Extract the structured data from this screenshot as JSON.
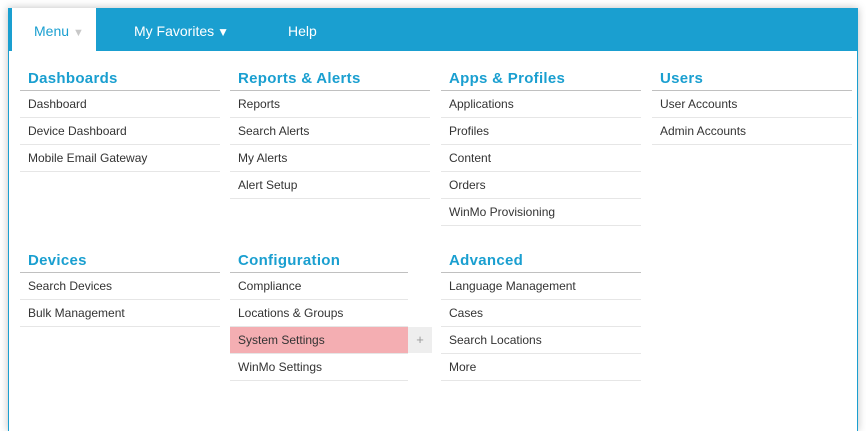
{
  "nav": {
    "menu_label": "Menu",
    "menu_caret": "▼",
    "favorites_label": "My Favorites",
    "favorites_caret": "▼",
    "help_label": "Help"
  },
  "sections": {
    "dashboards": {
      "title": "Dashboards",
      "items": [
        "Dashboard",
        "Device Dashboard",
        "Mobile Email Gateway"
      ]
    },
    "reports": {
      "title": "Reports & Alerts",
      "items": [
        "Reports",
        "Search Alerts",
        "My Alerts",
        "Alert Setup"
      ]
    },
    "apps": {
      "title": "Apps & Profiles",
      "items": [
        "Applications",
        "Profiles",
        "Content",
        "Orders",
        "WinMo Provisioning"
      ]
    },
    "users": {
      "title": "Users",
      "items": [
        "User Accounts",
        "Admin Accounts"
      ]
    },
    "devices": {
      "title": "Devices",
      "items": [
        "Search Devices",
        "Bulk Management"
      ]
    },
    "configuration": {
      "title": "Configuration",
      "items": [
        "Compliance",
        "Locations & Groups",
        "System Settings",
        "WinMo Settings"
      ],
      "add_symbol": "+"
    },
    "advanced": {
      "title": "Advanced",
      "items": [
        "Language Management",
        "Cases",
        "Search Locations",
        "More"
      ]
    }
  },
  "colors": {
    "accent": "#1a9fd0",
    "highlight": "#f4aeb2",
    "text": "#333333"
  },
  "icons": {
    "caret": "chevron-down-icon",
    "add": "plus-icon"
  }
}
